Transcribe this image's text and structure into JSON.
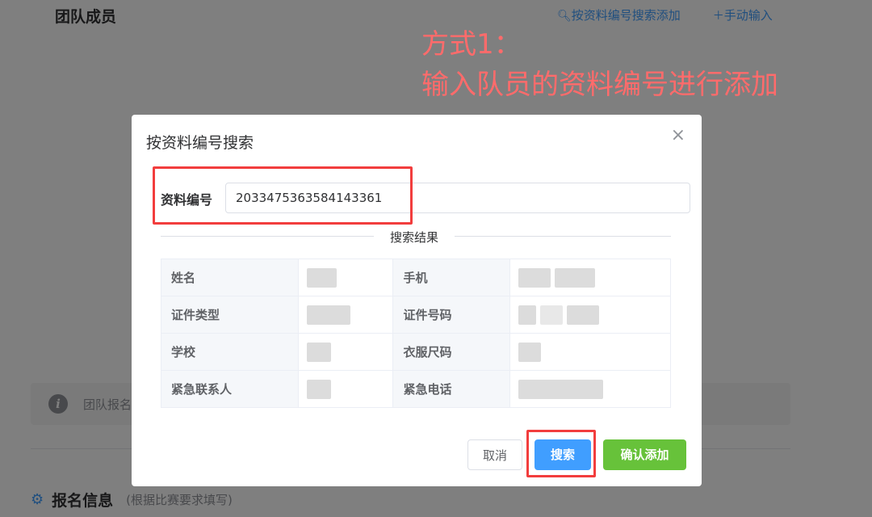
{
  "page": {
    "title": "团队成员",
    "search_add_link": "按资料编号搜索添加",
    "manual_input_link": "手动输入",
    "notice_text": "团队报名",
    "section_title": "报名信息",
    "section_hint": "(根据比赛要求填写)"
  },
  "annotation": {
    "line1": "方式1：",
    "line2": "输入队员的资料编号进行添加"
  },
  "dialog": {
    "title": "按资料编号搜索",
    "close_symbol": "×",
    "field_label": "资料编号",
    "field_value": "2033475363584143361",
    "result_title": "搜索结果",
    "rows": [
      {
        "label1": "姓名",
        "label2": "手机"
      },
      {
        "label1": "证件类型",
        "label2": "证件号码"
      },
      {
        "label1": "学校",
        "label2": "衣服尺码"
      },
      {
        "label1": "紧急联系人",
        "label2": "紧急电话"
      }
    ],
    "cancel_label": "取消",
    "search_label": "搜索",
    "confirm_label": "确认添加"
  },
  "icons": {
    "search": "search-icon",
    "plus": "plus-icon",
    "info": "info-icon",
    "gear": "gear-icon",
    "close": "close-icon"
  },
  "colors": {
    "primary": "#409eff",
    "success": "#67c23a",
    "annotation": "#ff6b6b",
    "highlight_box": "#f23d3d"
  }
}
